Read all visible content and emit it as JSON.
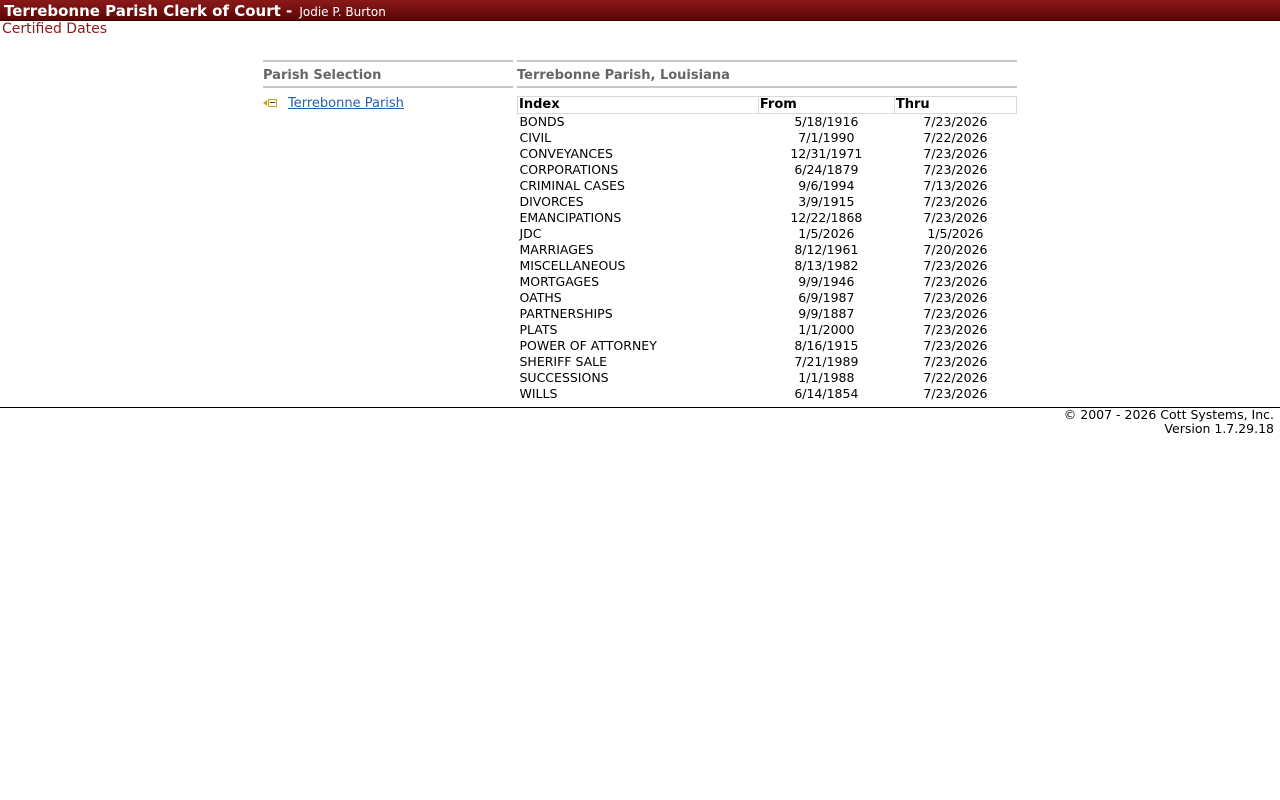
{
  "header": {
    "org_title": "Terrebonne Parish Clerk of Court -",
    "official_name": "Jodie P. Burton"
  },
  "page_subtitle": "Certified Dates",
  "parish_panel": {
    "title": "Parish Selection",
    "items": [
      {
        "label": "Terrebonne Parish",
        "icon": "parish-select-icon"
      }
    ]
  },
  "dates_panel": {
    "title": "Terrebonne Parish, Louisiana",
    "columns": [
      "Index",
      "From",
      "Thru"
    ],
    "rows": [
      [
        "BONDS",
        "5/18/1916",
        "7/23/2026"
      ],
      [
        "CIVIL",
        "7/1/1990",
        "7/22/2026"
      ],
      [
        "CONVEYANCES",
        "12/31/1971",
        "7/23/2026"
      ],
      [
        "CORPORATIONS",
        "6/24/1879",
        "7/23/2026"
      ],
      [
        "CRIMINAL CASES",
        "9/6/1994",
        "7/13/2026"
      ],
      [
        "DIVORCES",
        "3/9/1915",
        "7/23/2026"
      ],
      [
        "EMANCIPATIONS",
        "12/22/1868",
        "7/23/2026"
      ],
      [
        "JDC",
        "1/5/2026",
        "1/5/2026"
      ],
      [
        "MARRIAGES",
        "8/12/1961",
        "7/20/2026"
      ],
      [
        "MISCELLANEOUS",
        "8/13/1982",
        "7/23/2026"
      ],
      [
        "MORTGAGES",
        "9/9/1946",
        "7/23/2026"
      ],
      [
        "OATHS",
        "6/9/1987",
        "7/23/2026"
      ],
      [
        "PARTNERSHIPS",
        "9/9/1887",
        "7/23/2026"
      ],
      [
        "PLATS",
        "1/1/2000",
        "7/23/2026"
      ],
      [
        "POWER OF ATTORNEY",
        "8/16/1915",
        "7/23/2026"
      ],
      [
        "SHERIFF SALE",
        "7/21/1989",
        "7/23/2026"
      ],
      [
        "SUCCESSIONS",
        "1/1/1988",
        "7/22/2026"
      ],
      [
        "WILLS",
        "6/14/1854",
        "7/23/2026"
      ]
    ]
  },
  "footer": {
    "copyright": "© 2007 - 2026 Cott Systems, Inc.",
    "version": "Version 1.7.29.18"
  },
  "colors": {
    "header_bar": "#6b0c0c",
    "subtitle": "#8b1a1a",
    "link": "#2a5db0",
    "panel_title": "#666666"
  }
}
